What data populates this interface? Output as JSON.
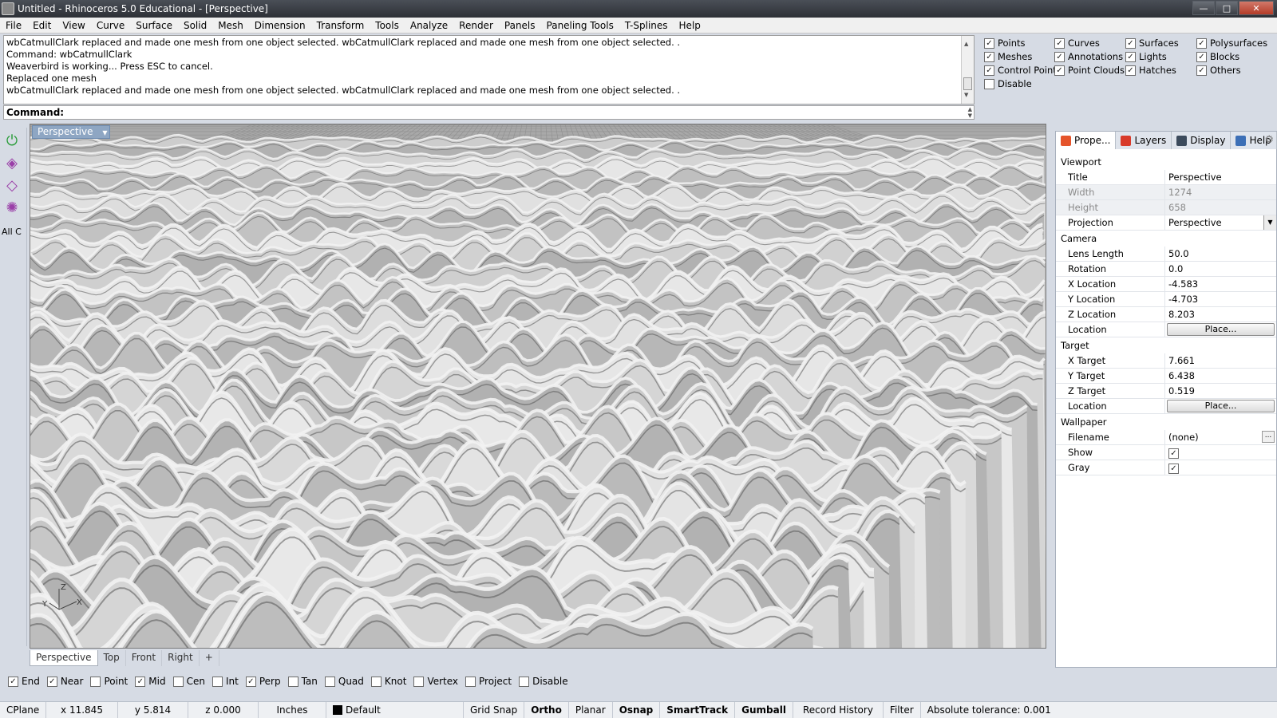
{
  "window": {
    "title": "Untitled - Rhinoceros 5.0 Educational - [Perspective]",
    "minimize": "—",
    "maximize": "□",
    "close": "✕"
  },
  "menu": [
    "File",
    "Edit",
    "View",
    "Curve",
    "Surface",
    "Solid",
    "Mesh",
    "Dimension",
    "Transform",
    "Tools",
    "Analyze",
    "Render",
    "Panels",
    "Paneling Tools",
    "T-Splines",
    "Help"
  ],
  "command_history": [
    "wbCatmullClark replaced and made one mesh from one object selected. wbCatmullClark replaced and made one mesh from one object selected. .",
    "Command: wbCatmullClark",
    "Weaverbird is working... Press ESC to cancel.",
    "Replaced one mesh",
    "wbCatmullClark replaced and made one mesh from one object selected. wbCatmullClark replaced and made one mesh from one object selected. ."
  ],
  "command_prompt": "Command:",
  "visibility_filters": [
    {
      "label": "Points",
      "checked": true
    },
    {
      "label": "Curves",
      "checked": true
    },
    {
      "label": "Surfaces",
      "checked": true
    },
    {
      "label": "Polysurfaces",
      "checked": true
    },
    {
      "label": "Meshes",
      "checked": true
    },
    {
      "label": "Annotations",
      "checked": true
    },
    {
      "label": "Lights",
      "checked": true
    },
    {
      "label": "Blocks",
      "checked": true
    },
    {
      "label": "Control Points",
      "checked": true
    },
    {
      "label": "Point Clouds",
      "checked": true
    },
    {
      "label": "Hatches",
      "checked": true
    },
    {
      "label": "Others",
      "checked": true
    },
    {
      "label": "Disable",
      "checked": false
    }
  ],
  "left_tools": {
    "all_c_label": "All C",
    "icons": [
      "power-icon",
      "box-icon",
      "surface-icon",
      "gear-cluster-icon"
    ]
  },
  "viewport": {
    "label": "Perspective",
    "axis_z": "Z",
    "axis_y": "Y",
    "axis_x": "X",
    "background_color": "#a9a9a9",
    "mesh_color": "#f2f2f2",
    "grid_color": "#8f8f8f"
  },
  "viewport_tabs": [
    "Perspective",
    "Top",
    "Front",
    "Right",
    "+"
  ],
  "osnaps": [
    {
      "label": "End",
      "checked": true
    },
    {
      "label": "Near",
      "checked": true
    },
    {
      "label": "Point",
      "checked": false
    },
    {
      "label": "Mid",
      "checked": true
    },
    {
      "label": "Cen",
      "checked": false
    },
    {
      "label": "Int",
      "checked": false
    },
    {
      "label": "Perp",
      "checked": true
    },
    {
      "label": "Tan",
      "checked": false
    },
    {
      "label": "Quad",
      "checked": false
    },
    {
      "label": "Knot",
      "checked": false
    },
    {
      "label": "Vertex",
      "checked": false
    },
    {
      "label": "Project",
      "checked": false
    },
    {
      "label": "Disable",
      "checked": false
    }
  ],
  "status_bar": {
    "cplane": "CPlane",
    "x": "x 11.845",
    "y": "y 5.814",
    "z": "z 0.000",
    "units": "Inches",
    "layer": "Default",
    "grid_snap": "Grid Snap",
    "ortho": "Ortho",
    "planar": "Planar",
    "osnap": "Osnap",
    "smarttrack": "SmartTrack",
    "gumball": "Gumball",
    "record_history": "Record History",
    "filter": "Filter",
    "tolerance": "Absolute tolerance: 0.001"
  },
  "right_panel": {
    "tabs": [
      {
        "label": "Prope...",
        "icon": "properties-icon",
        "color": "#e5542b"
      },
      {
        "label": "Layers",
        "icon": "layers-icon",
        "color": "#d83a2a"
      },
      {
        "label": "Display",
        "icon": "display-icon",
        "color": "#3b4a5c"
      },
      {
        "label": "Help",
        "icon": "help-icon",
        "color": "#3c6fb6"
      }
    ],
    "sections": {
      "viewport": "Viewport",
      "camera": "Camera",
      "target": "Target",
      "wallpaper": "Wallpaper"
    },
    "viewport_rows": {
      "title_k": "Title",
      "title_v": "Perspective",
      "width_k": "Width",
      "width_v": "1274",
      "height_k": "Height",
      "height_v": "658",
      "projection_k": "Projection",
      "projection_v": "Perspective"
    },
    "camera_rows": {
      "lens_k": "Lens Length",
      "lens_v": "50.0",
      "rotation_k": "Rotation",
      "rotation_v": "0.0",
      "xloc_k": "X Location",
      "xloc_v": "-4.583",
      "yloc_k": "Y Location",
      "yloc_v": "-4.703",
      "zloc_k": "Z Location",
      "zloc_v": "8.203",
      "loc_k": "Location",
      "loc_btn": "Place..."
    },
    "target_rows": {
      "xt_k": "X Target",
      "xt_v": "7.661",
      "yt_k": "Y Target",
      "yt_v": "6.438",
      "zt_k": "Z Target",
      "zt_v": "0.519",
      "loc_k": "Location",
      "loc_btn": "Place..."
    },
    "wallpaper_rows": {
      "filename_k": "Filename",
      "filename_v": "(none)",
      "show_k": "Show",
      "show_v": true,
      "gray_k": "Gray",
      "gray_v": true
    }
  }
}
